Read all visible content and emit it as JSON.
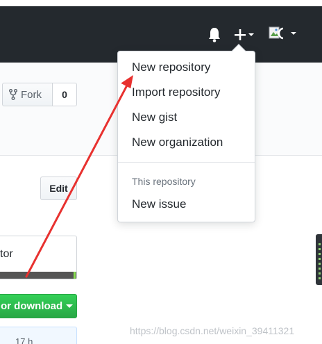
{
  "header": {
    "bell_icon": "bell-icon",
    "plus_icon": "plus-icon",
    "avatar_icon": "broken-image-avatar-icon"
  },
  "repo": {
    "fork_label": "Fork",
    "fork_count": "0",
    "edit_label": "Edit",
    "contributors_fragment": "tor",
    "clone_label": "or download",
    "commit_fragment": "17 h"
  },
  "dropdown": {
    "items": [
      "New repository",
      "Import repository",
      "New gist",
      "New organization"
    ],
    "section_header": "This repository",
    "section_items": [
      "New issue"
    ]
  },
  "annotation": {
    "arrow_color": "#e8312f"
  },
  "watermark": "https://blog.csdn.net/weixin_39411321",
  "colors": {
    "header_bg": "#24292e",
    "clone_green": "#28a745",
    "language_bar": "#555555"
  }
}
